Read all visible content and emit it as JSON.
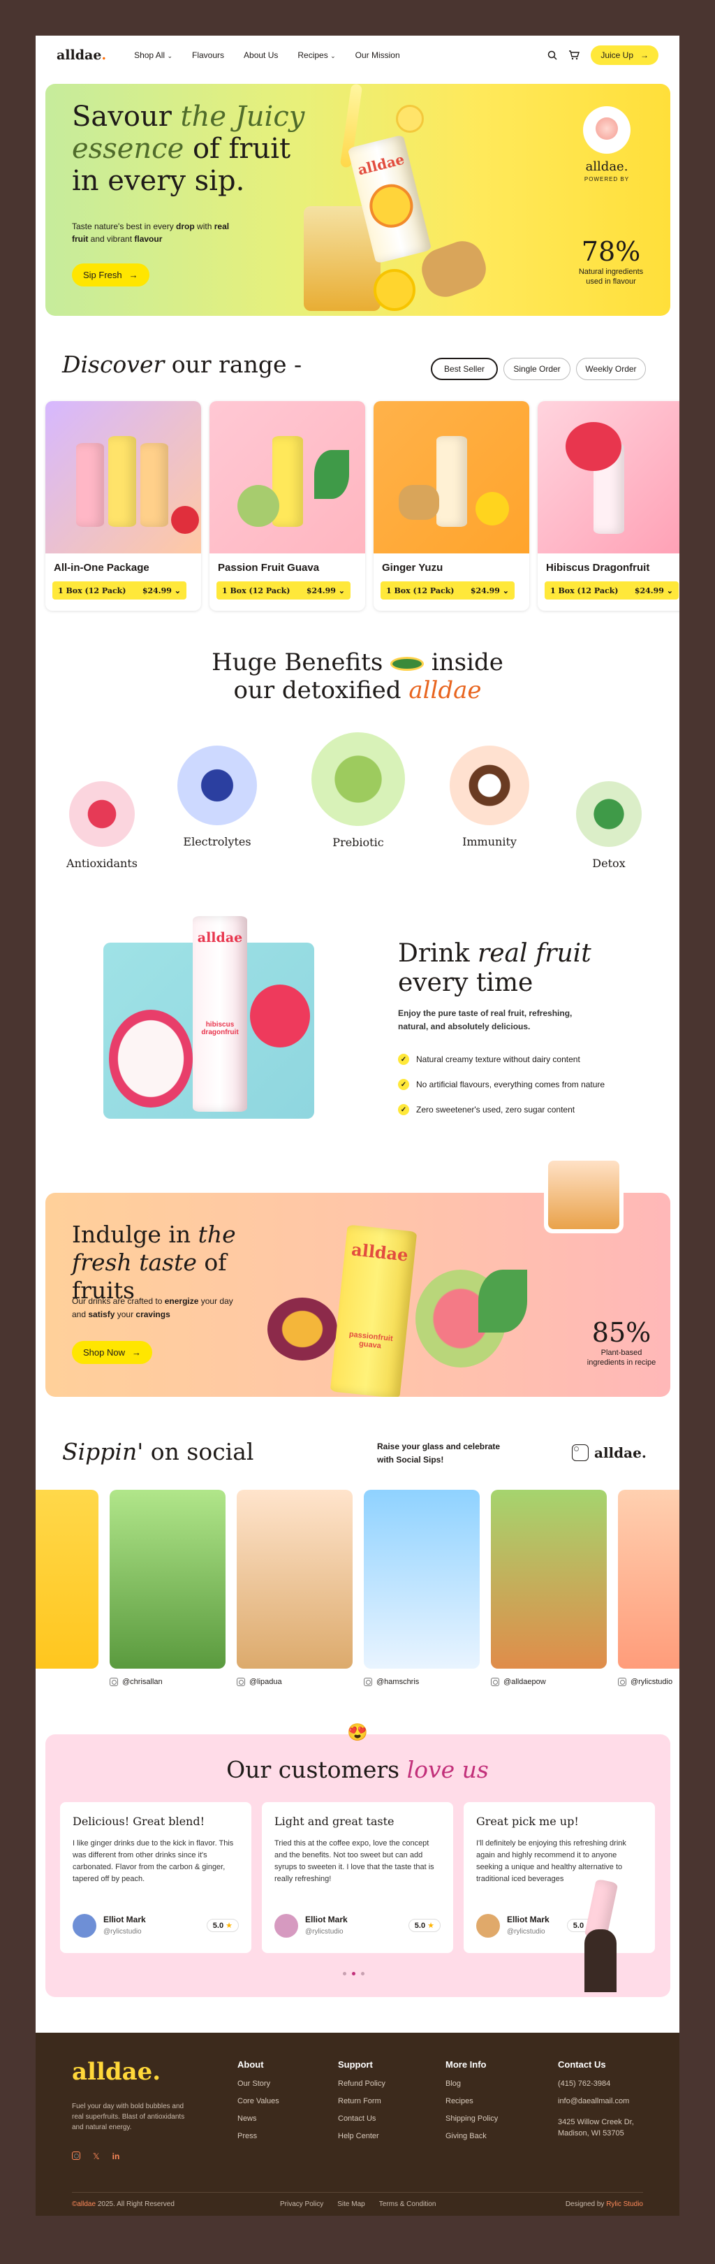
{
  "nav": {
    "logo": "alldae",
    "logo_dot": ".",
    "menu": [
      "Shop All",
      "Flavours",
      "About Us",
      "Recipes",
      "Our Mission"
    ],
    "cta": "Juice Up"
  },
  "hero": {
    "title_1": "Savour ",
    "title_em": "the Juicy essence",
    "title_2": " of fruit in every sip.",
    "desc_1": "Taste nature's best in every ",
    "desc_b1": "drop",
    "desc_2": " with ",
    "desc_b2": "real fruit",
    "desc_3": " and vibrant ",
    "desc_b3": "flavour",
    "cta": "Sip Fresh",
    "badge_brand": "alldae.",
    "badge_sub": "POWERED BY",
    "stat_value": "78%",
    "stat_label": "Natural ingredients used in flavour",
    "can_label": "alldae"
  },
  "range": {
    "title_em": "Discover",
    "title_rest": " our range -",
    "filters": [
      "Best Seller",
      "Single Order",
      "Weekly Order"
    ],
    "products": [
      {
        "name": "All-in-One Package",
        "pack": "1 Box (12 Pack)",
        "price": "$24.99"
      },
      {
        "name": "Passion Fruit Guava",
        "pack": "1 Box (12 Pack)",
        "price": "$24.99"
      },
      {
        "name": "Ginger Yuzu",
        "pack": "1 Box (12 Pack)",
        "price": "$24.99"
      },
      {
        "name": "Hibiscus Dragonfruit",
        "pack": "1 Box (12 Pack)",
        "price": "$24.99"
      }
    ]
  },
  "benefits": {
    "line1_a": "Huge Benefits",
    "line1_b": "inside",
    "line2_a": "our detoxified ",
    "line2_em": "alldae",
    "items": [
      "Antioxidants",
      "Electrolytes",
      "Prebiotic",
      "Immunity",
      "Detox"
    ]
  },
  "drink": {
    "title_1": "Drink ",
    "title_em": "real fruit",
    "title_2": "every time",
    "desc": "Enjoy the pure taste of real fruit, refreshing, natural, and absolutely delicious.",
    "checks": [
      "Natural creamy texture without dairy content",
      "No artificial flavours, everything comes from nature",
      "Zero sweetener's used, zero sugar content"
    ],
    "can_label": "alldae",
    "can_flavour": "hibiscus dragonfruit"
  },
  "indulge": {
    "title_1": "Indulge in ",
    "title_em": "the fresh taste",
    "title_2": " of fruits",
    "desc_1": "Our drinks are crafted to ",
    "desc_b1": "energize",
    "desc_2": " your day and ",
    "desc_b2": "satisfy",
    "desc_3": " your ",
    "desc_b3": "cravings",
    "cta": "Shop Now",
    "stat_value": "85%",
    "stat_label": "Plant-based ingredients in recipe",
    "can_label": "alldae",
    "can_flavour": "passionfruit guava"
  },
  "social": {
    "title_em": "Sippin'",
    "title_rest": " on social",
    "desc": "Raise your glass and celebrate with Social Sips!",
    "ig_name": "alldae.",
    "handles": [
      "@chrisallan",
      "@lipadua",
      "@hamschris",
      "@alldaepow",
      "@rylicstudio"
    ]
  },
  "reviews": {
    "emoji": "😍",
    "title_1": "Our customers ",
    "title_em": "love us",
    "items": [
      {
        "title": "Delicious! Great blend!",
        "text": "I like ginger drinks due to the kick in flavor. This was different from other drinks since it's carbonated. Flavor from the carbon & ginger, tapered off by peach.",
        "name": "Elliot Mark",
        "handle": "@rylicstudio",
        "score": "5.0"
      },
      {
        "title": "Light and great taste",
        "text": "Tried this at the coffee expo, love the concept and the benefits. Not too sweet but can add syrups to sweeten it. I love that the taste that is really refreshing!",
        "name": "Elliot Mark",
        "handle": "@rylicstudio",
        "score": "5.0"
      },
      {
        "title": "Great pick me up!",
        "text": "I'll definitely be enjoying this refreshing drink again and highly recommend it to anyone seeking a unique and healthy alternative to traditional iced beverages",
        "name": "Elliot Mark",
        "handle": "@rylicstudio",
        "score": "5.0"
      }
    ]
  },
  "footer": {
    "logo": "alldae.",
    "tagline": "Fuel your day with bold bubbles and real superfruits. Blast of antioxidants and natural energy.",
    "about_title": "About",
    "about": [
      "Our Story",
      "Core Values",
      "News",
      "Press"
    ],
    "support_title": "Support",
    "support": [
      "Refund Policy",
      "Return Form",
      "Contact Us",
      "Help Center"
    ],
    "more_title": "More Info",
    "more": [
      "Blog",
      "Recipes",
      "Shipping Policy",
      "Giving Back"
    ],
    "contact_title": "Contact Us",
    "phone": "(415) 762-3984",
    "email": "info@daeallmail.com",
    "address_1": "3425 Willow Creek Dr,",
    "address_2": "Madison, WI 53705",
    "copyright_brand": "©alldae",
    "copyright_rest": " 2025. All Right Reserved",
    "legal": [
      "Privacy Policy",
      "Site Map",
      "Terms & Condition"
    ],
    "designed_by": "Designed by ",
    "designer": "Rylic Studio"
  }
}
